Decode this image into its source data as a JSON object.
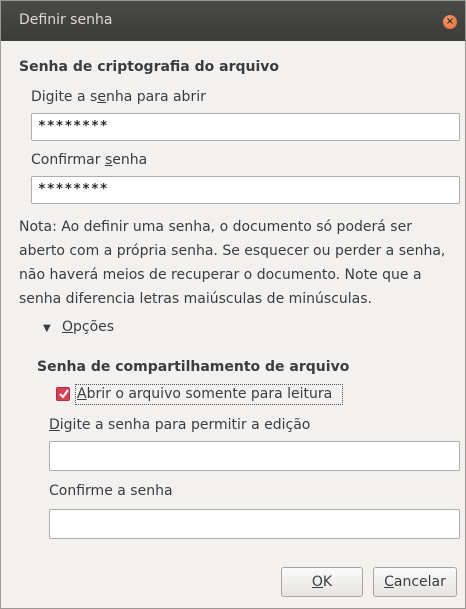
{
  "window": {
    "title": "Definir senha",
    "close_glyph": "×"
  },
  "encryption": {
    "heading": "Senha de criptografia do arquivo",
    "open_label_pre": "Digite a s",
    "open_label_mnemonic": "e",
    "open_label_post": "nha para abrir",
    "open_value": "********",
    "confirm_label_pre": "Confirmar ",
    "confirm_label_mnemonic": "s",
    "confirm_label_post": "enha",
    "confirm_value": "********"
  },
  "note": "Nota: Ao definir uma senha, o documento só poderá ser aberto com a própria senha. Se esquecer ou perder a senha, não haverá meios de recuperar o documento. Note que a senha diferencia letras maiúsculas de minúsculas.",
  "options": {
    "expander_arrow": "▼",
    "label_pre": "",
    "label_mnemonic": "O",
    "label_post": "pções",
    "expanded": true
  },
  "sharing": {
    "heading": "Senha de compartilhamento de arquivo",
    "readonly_checked": true,
    "readonly_label_pre": "",
    "readonly_label_mnemonic": "A",
    "readonly_label_post": "brir o arquivo somente para leitura",
    "edit_label_pre": "",
    "edit_label_mnemonic": "D",
    "edit_label_post": "igite a senha para permitir a edição",
    "edit_value": "",
    "confirm_label_pre": "Conf",
    "confirm_label_mnemonic": "i",
    "confirm_label_post": "rme a senha",
    "confirm_value": ""
  },
  "buttons": {
    "ok_mnemonic": "O",
    "ok_post": "K",
    "cancel_mnemonic": "C",
    "cancel_post": "ancelar"
  },
  "colors": {
    "titlebar": "#3b3b39",
    "dialog_bg": "#f2f1f0",
    "checkbox_accent": "#d64050",
    "close_button": "#e46a34"
  }
}
